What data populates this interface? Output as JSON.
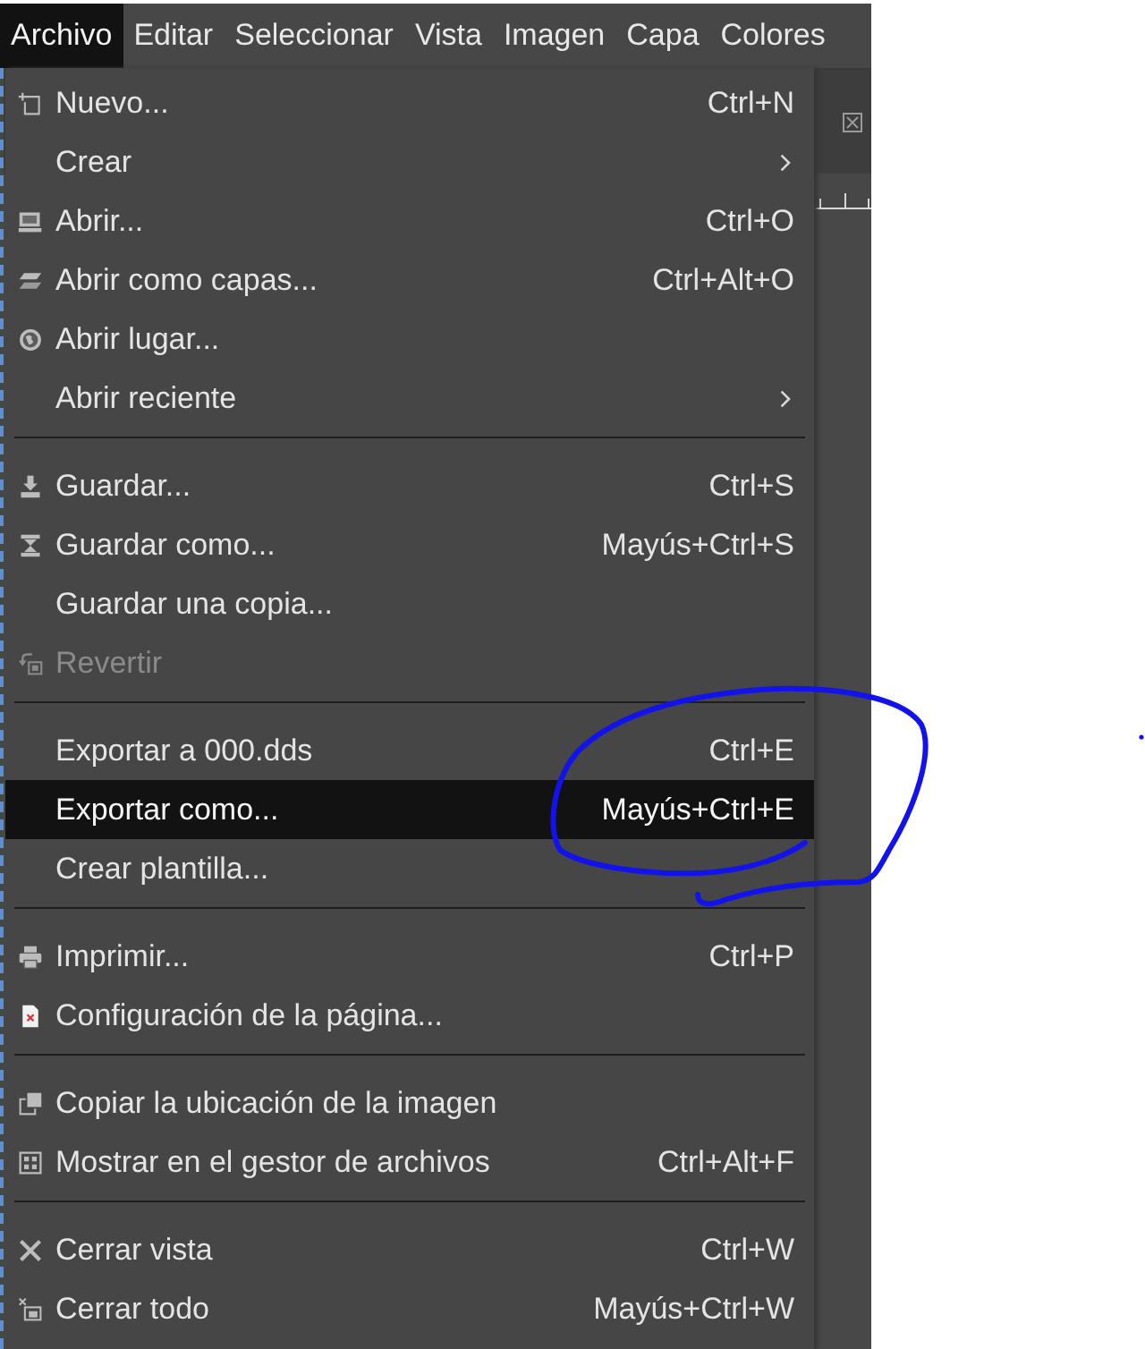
{
  "menubar": {
    "items": [
      {
        "label": "Archivo",
        "selected": true
      },
      {
        "label": "Editar",
        "selected": false
      },
      {
        "label": "Seleccionar",
        "selected": false
      },
      {
        "label": "Vista",
        "selected": false
      },
      {
        "label": "Imagen",
        "selected": false
      },
      {
        "label": "Capa",
        "selected": false
      },
      {
        "label": "Colores",
        "selected": false
      }
    ]
  },
  "menu": {
    "sections": [
      {
        "items": [
          {
            "label": "Nuevo...",
            "shortcut": "Ctrl+N",
            "submenu": false,
            "disabled": false,
            "selected": false
          },
          {
            "label": "Crear",
            "submenu": true,
            "disabled": false,
            "selected": false
          },
          {
            "label": "Abrir...",
            "shortcut": "Ctrl+O",
            "submenu": false,
            "disabled": false,
            "selected": false
          },
          {
            "label": "Abrir como capas...",
            "shortcut": "Ctrl+Alt+O",
            "submenu": false,
            "disabled": false,
            "selected": false
          },
          {
            "label": "Abrir lugar...",
            "submenu": false,
            "disabled": false,
            "selected": false
          },
          {
            "label": "Abrir reciente",
            "submenu": true,
            "disabled": false,
            "selected": false
          }
        ]
      },
      {
        "items": [
          {
            "label": "Guardar...",
            "shortcut": "Ctrl+S",
            "submenu": false,
            "disabled": false,
            "selected": false
          },
          {
            "label": "Guardar como...",
            "shortcut": "Mayús+Ctrl+S",
            "submenu": false,
            "disabled": false,
            "selected": false
          },
          {
            "label": "Guardar una copia...",
            "submenu": false,
            "disabled": false,
            "selected": false
          },
          {
            "label": "Revertir",
            "submenu": false,
            "disabled": true,
            "selected": false
          }
        ]
      },
      {
        "items": [
          {
            "label": "Exportar a 000.dds",
            "shortcut": "Ctrl+E",
            "submenu": false,
            "disabled": false,
            "selected": false
          },
          {
            "label": "Exportar como...",
            "shortcut": "Mayús+Ctrl+E",
            "submenu": false,
            "disabled": false,
            "selected": true
          },
          {
            "label": "Crear plantilla...",
            "submenu": false,
            "disabled": false,
            "selected": false
          }
        ]
      },
      {
        "items": [
          {
            "label": "Imprimir...",
            "shortcut": "Ctrl+P",
            "submenu": false,
            "disabled": false,
            "selected": false
          },
          {
            "label": "Configuración de la página...",
            "submenu": false,
            "disabled": false,
            "selected": false
          }
        ]
      },
      {
        "items": [
          {
            "label": "Copiar la ubicación de la imagen",
            "submenu": false,
            "disabled": false,
            "selected": false
          },
          {
            "label": "Mostrar en el gestor de archivos",
            "shortcut": "Ctrl+Alt+F",
            "submenu": false,
            "disabled": false,
            "selected": false
          }
        ]
      },
      {
        "items": [
          {
            "label": "Cerrar vista",
            "shortcut": "Ctrl+W",
            "submenu": false,
            "disabled": false,
            "selected": false
          },
          {
            "label": "Cerrar todo",
            "shortcut": "Mayús+Ctrl+W",
            "submenu": false,
            "disabled": false,
            "selected": false
          }
        ]
      }
    ]
  }
}
